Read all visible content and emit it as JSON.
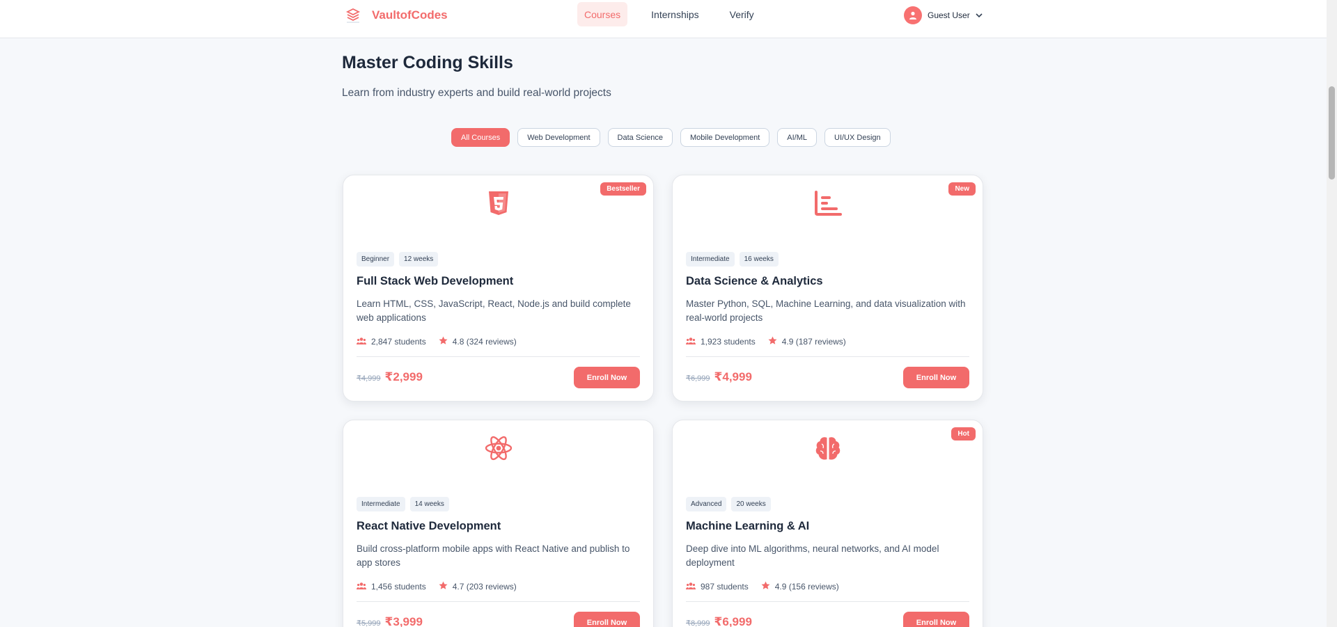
{
  "brand": {
    "name": "VaultofCodes"
  },
  "nav": {
    "courses": "Courses",
    "internships": "Internships",
    "verify": "Verify"
  },
  "user": {
    "name": "Guest User"
  },
  "page": {
    "title": "Master Coding Skills",
    "subtitle": "Learn from industry experts and build real-world projects"
  },
  "filters": [
    "All Courses",
    "Web Development",
    "Data Science",
    "Mobile Development",
    "AI/ML",
    "UI/UX Design"
  ],
  "courses": [
    {
      "badge": "Bestseller",
      "icon": "html5-icon",
      "level": "Beginner",
      "duration": "12 weeks",
      "title": "Full Stack Web Development",
      "description": "Learn HTML, CSS, JavaScript, React, Node.js and build complete web applications",
      "students": "2,847 students",
      "rating": "4.8 (324 reviews)",
      "old_price": "₹4,999",
      "price": "₹2,999",
      "cta": "Enroll Now"
    },
    {
      "badge": "New",
      "icon": "chart-bar-icon",
      "level": "Intermediate",
      "duration": "16 weeks",
      "title": "Data Science & Analytics",
      "description": "Master Python, SQL, Machine Learning, and data visualization with real-world projects",
      "students": "1,923 students",
      "rating": "4.9 (187 reviews)",
      "old_price": "₹6,999",
      "price": "₹4,999",
      "cta": "Enroll Now"
    },
    {
      "badge": "",
      "icon": "react-icon",
      "level": "Intermediate",
      "duration": "14 weeks",
      "title": "React Native Development",
      "description": "Build cross-platform mobile apps with React Native and publish to app stores",
      "students": "1,456 students",
      "rating": "4.7 (203 reviews)",
      "old_price": "₹5,999",
      "price": "₹3,999",
      "cta": "Enroll Now"
    },
    {
      "badge": "Hot",
      "icon": "brain-icon",
      "level": "Advanced",
      "duration": "20 weeks",
      "title": "Machine Learning & AI",
      "description": "Deep dive into ML algorithms, neural networks, and AI model deployment",
      "students": "987 students",
      "rating": "4.9 (156 reviews)",
      "old_price": "₹8,999",
      "price": "₹6,999",
      "cta": "Enroll Now"
    }
  ],
  "colors": {
    "accent": "#f26b6b",
    "background": "#f6f8fb"
  }
}
